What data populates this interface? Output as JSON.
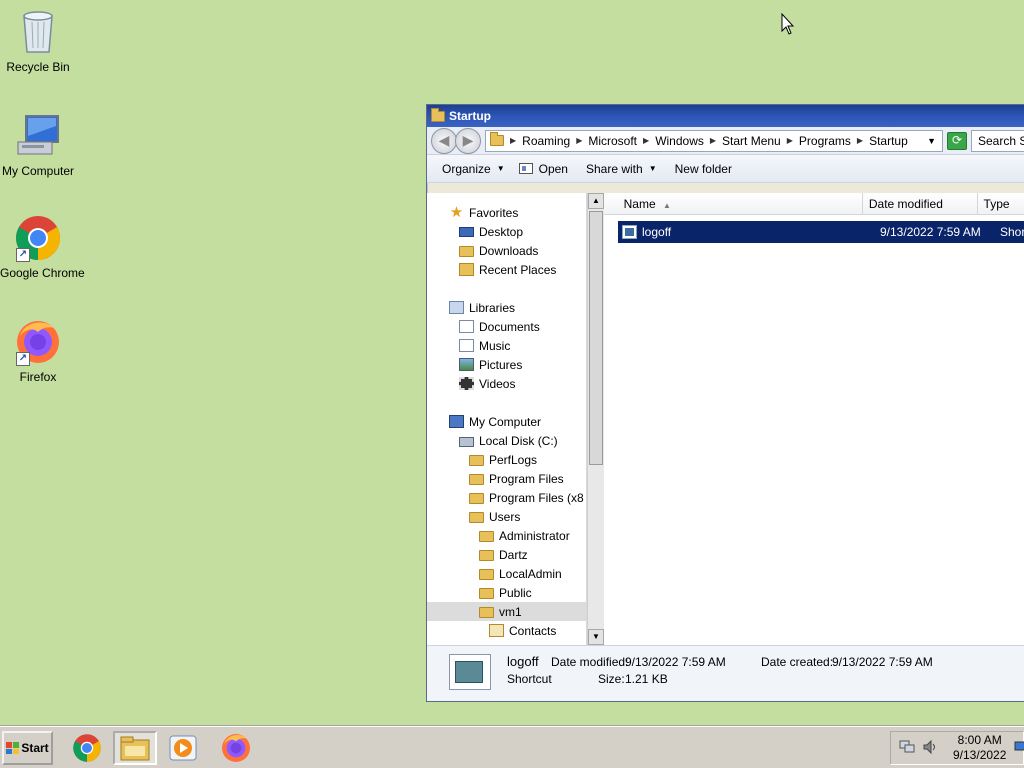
{
  "desktop": {
    "icons": [
      {
        "label": "Recycle Bin",
        "icon": "recycle-bin-icon"
      },
      {
        "label": "My Computer",
        "icon": "computer-icon"
      },
      {
        "label": "Google Chrome",
        "icon": "chrome-icon"
      },
      {
        "label": "Firefox",
        "icon": "firefox-icon"
      }
    ]
  },
  "window": {
    "title": "Startup",
    "breadcrumbs": [
      "Roaming",
      "Microsoft",
      "Windows",
      "Start Menu",
      "Programs",
      "Startup"
    ],
    "search_placeholder": "Search S",
    "toolbar": {
      "organize": "Organize",
      "open": "Open",
      "share_with": "Share with",
      "new_folder": "New folder"
    },
    "nav": {
      "favorites": "Favorites",
      "desktop": "Desktop",
      "downloads": "Downloads",
      "recent_places": "Recent Places",
      "libraries": "Libraries",
      "documents": "Documents",
      "music": "Music",
      "pictures": "Pictures",
      "videos": "Videos",
      "my_computer": "My Computer",
      "local_disk": "Local Disk (C:)",
      "perflogs": "PerfLogs",
      "program_files": "Program Files",
      "program_files_x86": "Program Files (x8",
      "users": "Users",
      "administrator": "Administrator",
      "dartz": "Dartz",
      "localadmin": "LocalAdmin",
      "public": "Public",
      "vm1": "vm1",
      "contacts": "Contacts"
    },
    "columns": {
      "name": "Name",
      "date_modified": "Date modified",
      "type": "Type"
    },
    "files": [
      {
        "name": "logoff",
        "date_modified": "9/13/2022 7:59 AM",
        "type": "Shortcut"
      }
    ],
    "details": {
      "name": "logoff",
      "type": "Shortcut",
      "date_modified_label": "Date modified:",
      "date_modified": "9/13/2022 7:59 AM",
      "date_created_label": "Date created:",
      "date_created": "9/13/2022 7:59 AM",
      "size_label": "Size:",
      "size": "1.21 KB"
    }
  },
  "taskbar": {
    "start_label": "Start",
    "time": "8:00 AM",
    "date": "9/13/2022"
  },
  "colors": {
    "desktop_bg": "#c4dea0",
    "selection": "#0a246a",
    "titlebar": "#2d55b5"
  }
}
